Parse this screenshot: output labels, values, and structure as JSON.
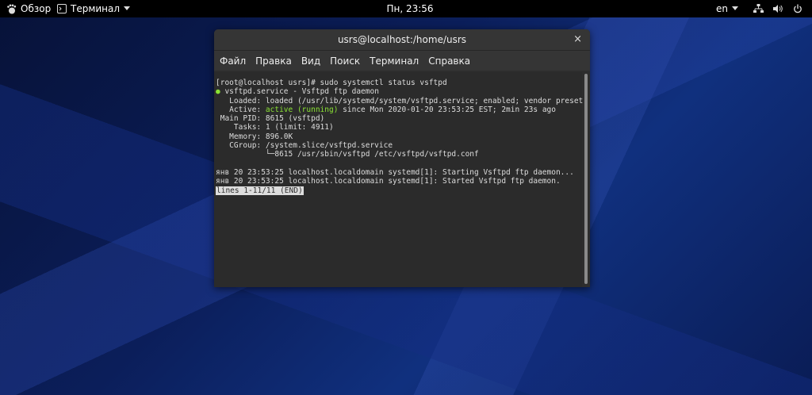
{
  "topbar": {
    "overview_label": "Обзор",
    "app_label": "Терминал",
    "clock": "Пн, 23:56",
    "language": "en",
    "icons": [
      "network-icon",
      "volume-icon",
      "power-icon"
    ]
  },
  "window": {
    "title": "usrs@localhost:/home/usrs",
    "close_glyph": "×",
    "menu": [
      "Файл",
      "Правка",
      "Вид",
      "Поиск",
      "Терминал",
      "Справка"
    ]
  },
  "terminal": {
    "prompt": "[root@localhost usrs]# sudo systemctl status vsftpd",
    "service_dot": "●",
    "service_line": " vsftpd.service - Vsftpd ftp daemon",
    "loaded_line": "   Loaded: loaded (/usr/lib/systemd/system/vsftpd.service; enabled; vendor preset: dis",
    "cursor_char": ">",
    "active_prefix": "   Active: ",
    "active_state": "active (running)",
    "active_suffix": " since Mon 2020-01-20 23:53:25 EST; 2min 23s ago",
    "mainpid_line": " Main PID: 8615 (vsftpd)",
    "tasks_line": "    Tasks: 1 (limit: 4911)",
    "memory_line": "   Memory: 896.0K",
    "cgroup_line": "   CGroup: /system.slice/vsftpd.service",
    "tree_line": "           └─8615 /usr/sbin/vsftpd /etc/vsftpd/vsftpd.conf",
    "log1": "янв 20 23:53:25 localhost.localdomain systemd[1]: Starting Vsftpd ftp daemon...",
    "log2": "янв 20 23:53:25 localhost.localdomain systemd[1]: Started Vsftpd ftp daemon.",
    "pager_status": "lines 1-11/11 (END)"
  }
}
